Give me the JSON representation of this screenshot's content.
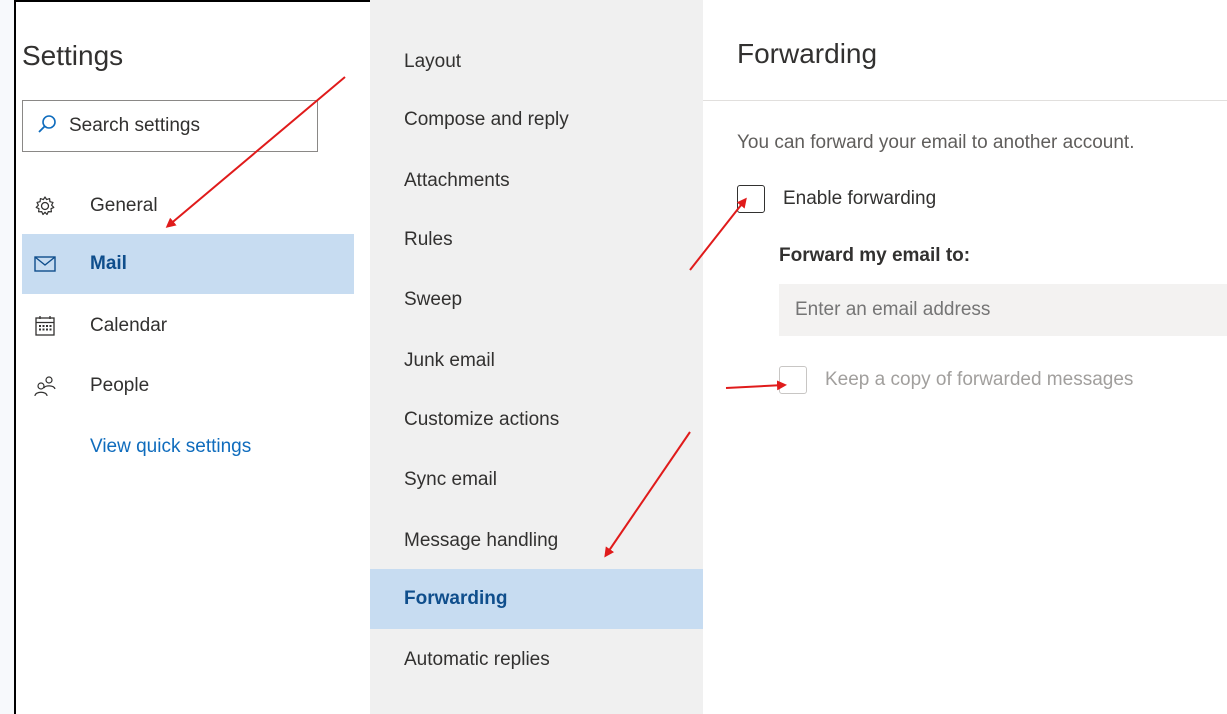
{
  "settings": {
    "title": "Settings",
    "search_placeholder": "Search settings",
    "nav": [
      {
        "label": "General",
        "icon": "gear-icon",
        "selected": false
      },
      {
        "label": "Mail",
        "icon": "mail-icon",
        "selected": true
      },
      {
        "label": "Calendar",
        "icon": "calendar-icon",
        "selected": false
      },
      {
        "label": "People",
        "icon": "people-icon",
        "selected": false
      }
    ],
    "quick_settings_link": "View quick settings"
  },
  "mail_menu": {
    "items": [
      {
        "label": "Layout",
        "selected": false
      },
      {
        "label": "Compose and reply",
        "selected": false
      },
      {
        "label": "Attachments",
        "selected": false
      },
      {
        "label": "Rules",
        "selected": false
      },
      {
        "label": "Sweep",
        "selected": false
      },
      {
        "label": "Junk email",
        "selected": false
      },
      {
        "label": "Customize actions",
        "selected": false
      },
      {
        "label": "Sync email",
        "selected": false
      },
      {
        "label": "Message handling",
        "selected": false
      },
      {
        "label": "Forwarding",
        "selected": true
      },
      {
        "label": "Automatic replies",
        "selected": false
      }
    ]
  },
  "forwarding": {
    "title": "Forwarding",
    "description": "You can forward your email to another account.",
    "enable_label": "Enable forwarding",
    "enable_checked": false,
    "forward_to_label": "Forward my email to:",
    "email_placeholder": "Enter an email address",
    "email_value": "",
    "keep_copy_label": "Keep a copy of forwarded messages",
    "keep_copy_checked": false,
    "keep_copy_disabled": true
  },
  "colors": {
    "selected_bg": "#c7dcf1",
    "selected_text": "#0f4e8c",
    "link": "#0f6cbd",
    "annotation_arrow": "#e01b1b"
  }
}
